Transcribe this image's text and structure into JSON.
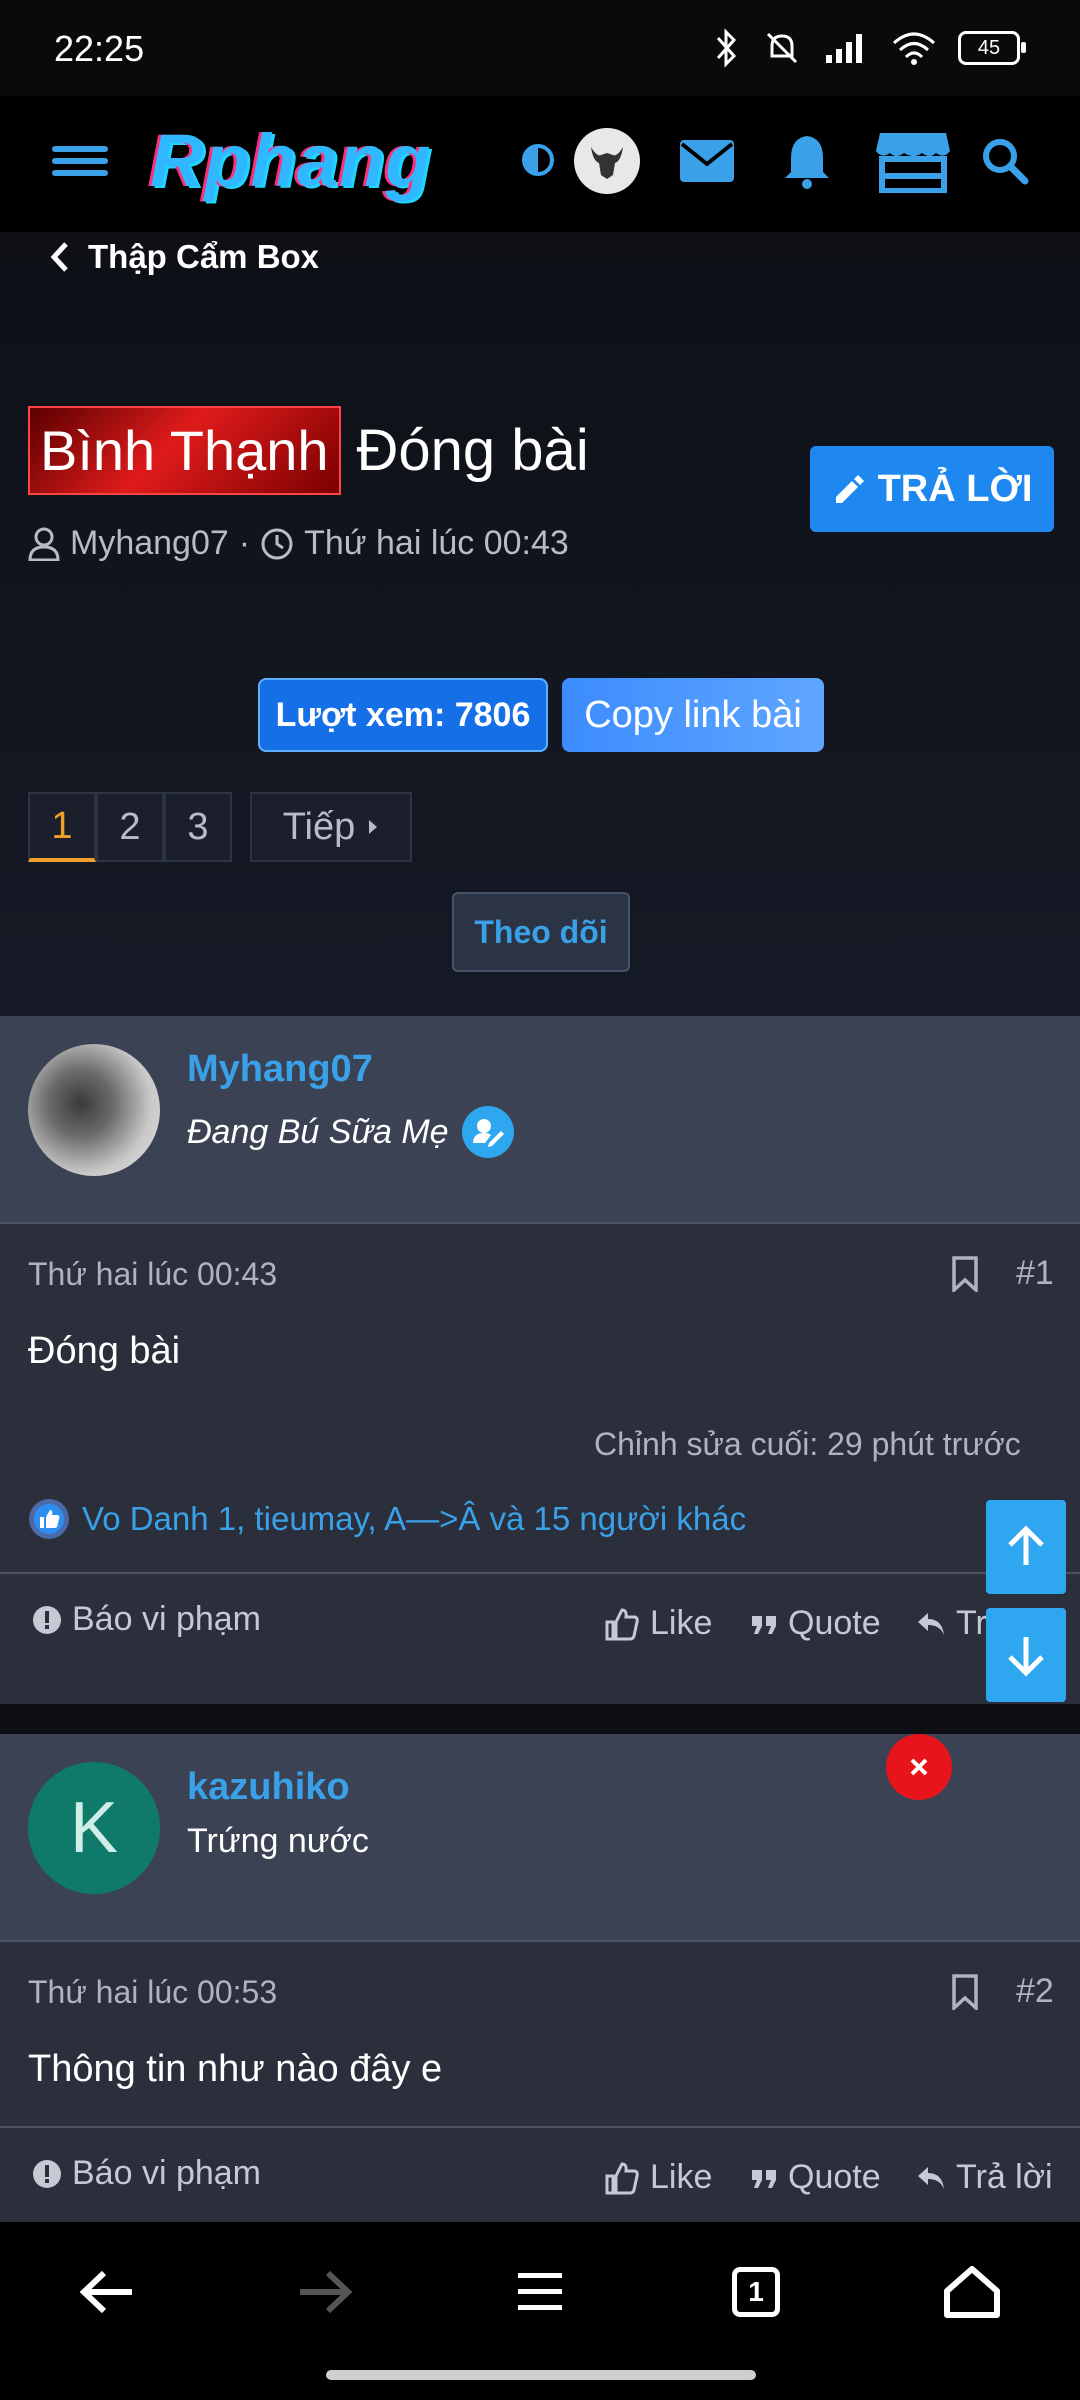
{
  "status": {
    "time": "22:25",
    "battery": "45"
  },
  "header": {
    "logo": "Rphang"
  },
  "breadcrumb": {
    "label": "Thập Cẩm Box"
  },
  "thread": {
    "prefix": "Bình Thạnh",
    "title": "Đóng bài",
    "reply_label": "TRẢ LỜI",
    "author": "Myhang07",
    "sep": "·",
    "time": "Thứ hai lúc 00:43",
    "views_label": "Lượt xem: 7806",
    "copy_label": "Copy link bài",
    "follow_label": "Theo dõi"
  },
  "pagination": {
    "pages": [
      "1",
      "2",
      "3"
    ],
    "active": "1",
    "next_label": "Tiếp"
  },
  "posts": [
    {
      "user": "Myhang07",
      "user_title": "Đang Bú Sữa Mẹ",
      "date": "Thứ hai lúc 00:43",
      "num": "#1",
      "text": "Đóng bài",
      "edited": "Chỉnh sửa cuối: 29 phút trước",
      "reactions": "Vo Danh 1, tieumay, A—>Â và 15 người khác",
      "report": "Báo vi phạm",
      "like": "Like",
      "quote": "Quote",
      "reply": "Trả lời",
      "reply_visible": "Tr"
    },
    {
      "user": "kazuhiko",
      "avatar_letter": "K",
      "user_title": "Trứng nước",
      "date": "Thứ hai lúc 00:53",
      "num": "#2",
      "text": "Thông tin như nào đây e",
      "report": "Báo vi phạm",
      "like": "Like",
      "quote": "Quote",
      "reply": "Trả lời"
    }
  ],
  "nav": {
    "tabs_count": "1"
  },
  "colors": {
    "accent": "#3aa0e8",
    "reply_button": "#1e88f0",
    "prefix_red": "#e01b1b",
    "active_page": "#f0a028"
  }
}
